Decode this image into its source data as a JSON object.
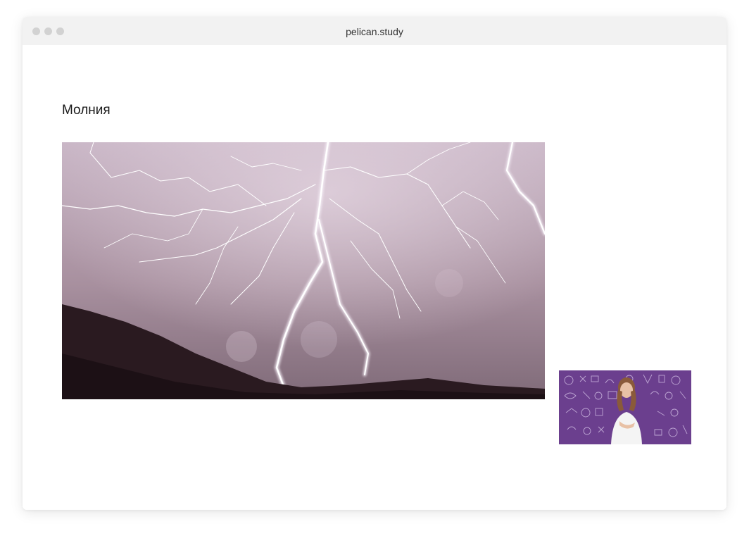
{
  "browser": {
    "url": "pelican.study"
  },
  "page": {
    "title": "Молния"
  },
  "hero_image": {
    "subject": "lightning-storm-photo"
  },
  "video": {
    "subject": "presenter-video-thumbnail"
  },
  "colors": {
    "titlebar": "#f2f2f2",
    "sky": "#b7a3b4",
    "hill": "#2a1a20",
    "video_bg": "#6b3f8e"
  }
}
